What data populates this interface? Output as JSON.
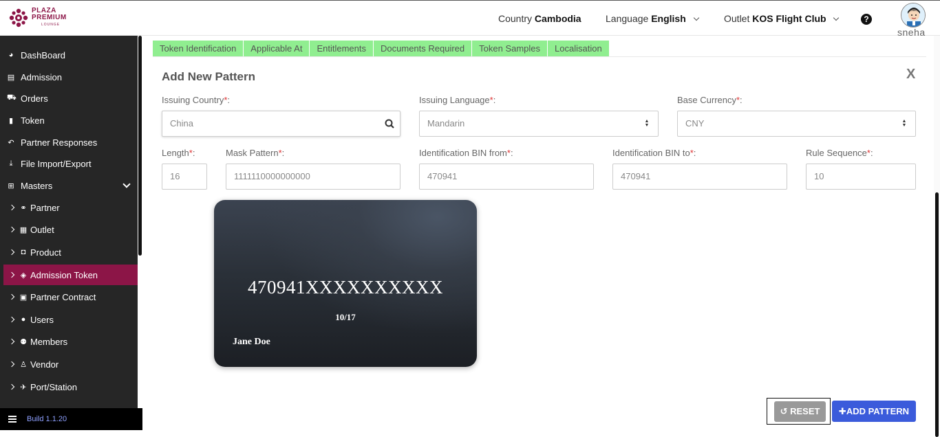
{
  "header": {
    "logo": {
      "line1": "PLAZA",
      "line2": "PREMIUM",
      "line3": "LOUNGE"
    },
    "country_label": "Country",
    "country_value": "Cambodia",
    "language_label": "Language",
    "language_value": "English",
    "outlet_label": "Outlet",
    "outlet_value": "KOS Flight Club",
    "help_glyph": "?",
    "username": "sneha"
  },
  "sidebar": {
    "items": [
      {
        "label": "DashBoard",
        "icon": "dashboard-icon"
      },
      {
        "label": "Admission",
        "icon": "id-card-icon"
      },
      {
        "label": "Orders",
        "icon": "cart-icon"
      },
      {
        "label": "Token",
        "icon": "file-icon"
      },
      {
        "label": "Partner Responses",
        "icon": "reply-icon"
      },
      {
        "label": "File Import/Export",
        "icon": "download-icon"
      },
      {
        "label": "Masters",
        "icon": "sitemap-icon"
      }
    ],
    "sub_items": [
      {
        "label": "Partner",
        "icon": "handshake-icon"
      },
      {
        "label": "Outlet",
        "icon": "building-icon"
      },
      {
        "label": "Product",
        "icon": "gift-icon"
      },
      {
        "label": "Admission Token",
        "icon": "ticket-icon"
      },
      {
        "label": "Partner Contract",
        "icon": "briefcase-icon"
      },
      {
        "label": "Users",
        "icon": "user-icon"
      },
      {
        "label": "Members",
        "icon": "users-icon"
      },
      {
        "label": "Vendor",
        "icon": "male-icon"
      },
      {
        "label": "Port/Station",
        "icon": "plane-icon"
      }
    ],
    "build": "Build 1.1.20"
  },
  "tabs": [
    "Token Identification",
    "Applicable At",
    "Entitlements",
    "Documents Required",
    "Token Samples",
    "Localisation"
  ],
  "form": {
    "title": "Add New Pattern",
    "close": "X",
    "issuing_country": {
      "label": "Issuing Country",
      "value": "China"
    },
    "issuing_language": {
      "label": "Issuing Language",
      "value": "Mandarin"
    },
    "base_currency": {
      "label": "Base Currency",
      "value": "CNY"
    },
    "length": {
      "label": "Length",
      "value": "16"
    },
    "mask_pattern": {
      "label": "Mask Pattern",
      "value": "1111110000000000"
    },
    "bin_from": {
      "label": "Identification BIN from",
      "value": "470941"
    },
    "bin_to": {
      "label": "Identification BIN to",
      "value": "470941"
    },
    "rule_sequence": {
      "label": "Rule Sequence",
      "value": "10"
    },
    "required_mark": "*",
    "colon": ":"
  },
  "card": {
    "number": "470941XXXXXXXXXX",
    "expiry": "10/17",
    "name": "Jane Doe"
  },
  "buttons": {
    "reset": "RESET",
    "add_pattern": "ADD PATTERN"
  },
  "colors": {
    "brand": "#8c1547",
    "tab_bg": "#90ee90",
    "primary_button": "#3b5bdb",
    "required": "#dd3333"
  }
}
